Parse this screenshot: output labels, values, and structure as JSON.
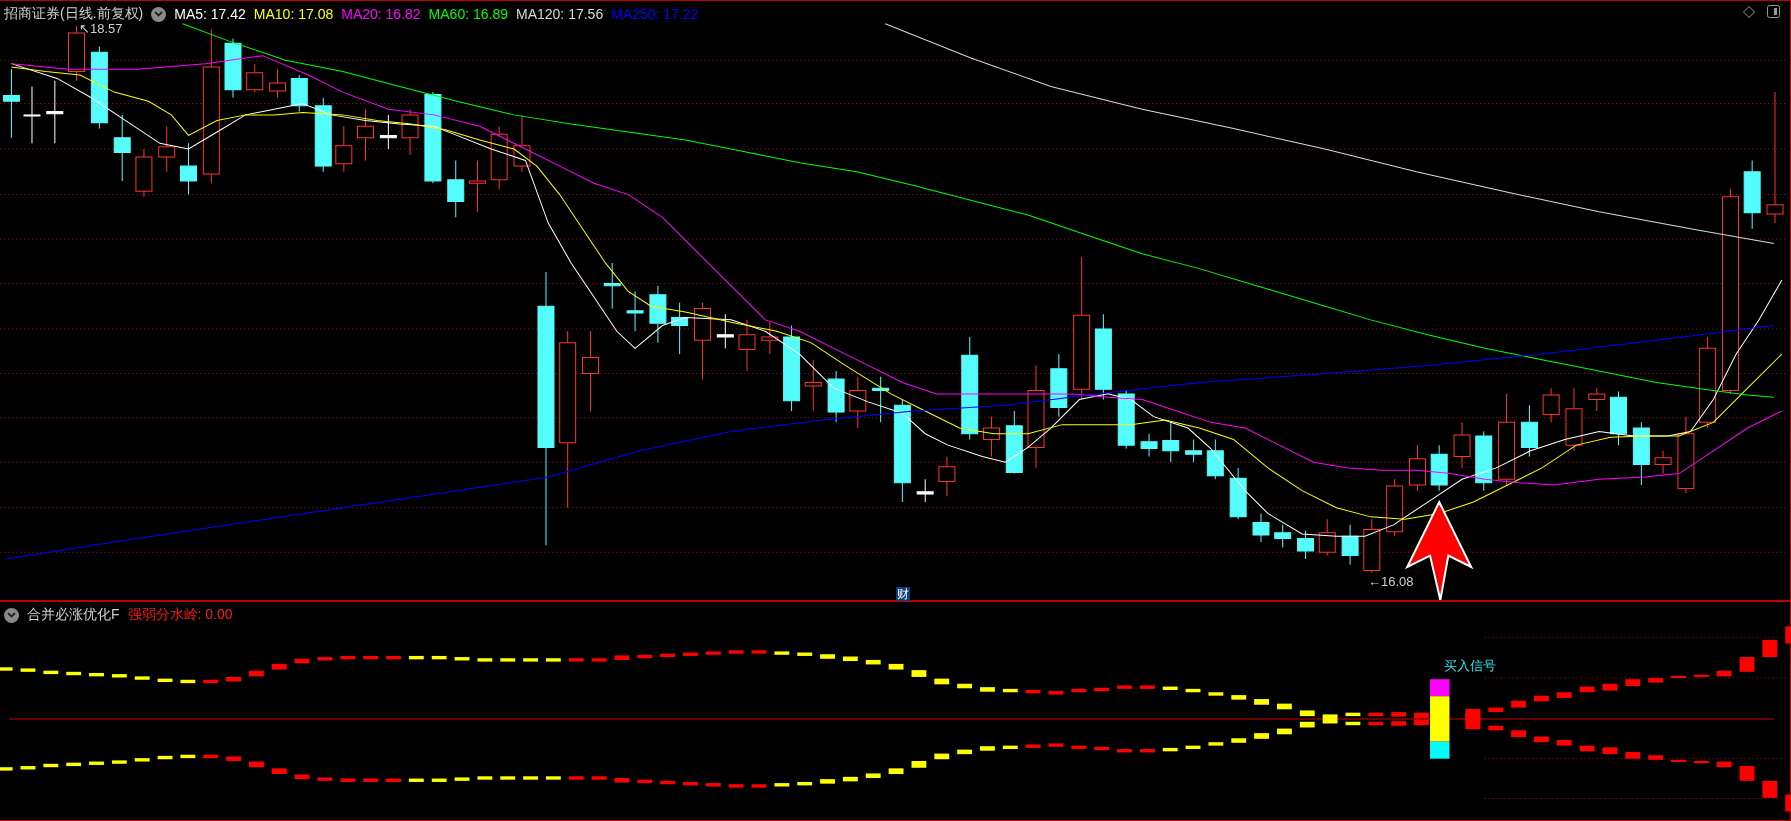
{
  "chart_header": {
    "title": "招商证券(日线.前复权)",
    "indicators": [
      {
        "label": "MA5: 17.42",
        "color": "#ffffff"
      },
      {
        "label": "MA10: 17.08",
        "color": "#ffff00"
      },
      {
        "label": "MA20: 16.82",
        "color": "#ff00ff"
      },
      {
        "label": "MA60: 16.89",
        "color": "#00ff00"
      },
      {
        "label": "MA120: 17.56",
        "color": "#d8d8d8"
      },
      {
        "label": "MA250: 17.22",
        "color": "#0000ff"
      }
    ]
  },
  "price_chart": {
    "high_label": "↖18.57",
    "low_label": "←16.08",
    "event_marker": "财"
  },
  "indicator_panel": {
    "title": "合并必涨优化F",
    "reading": "强弱分水岭: 0.00",
    "signal_label": "买入信号"
  }
}
